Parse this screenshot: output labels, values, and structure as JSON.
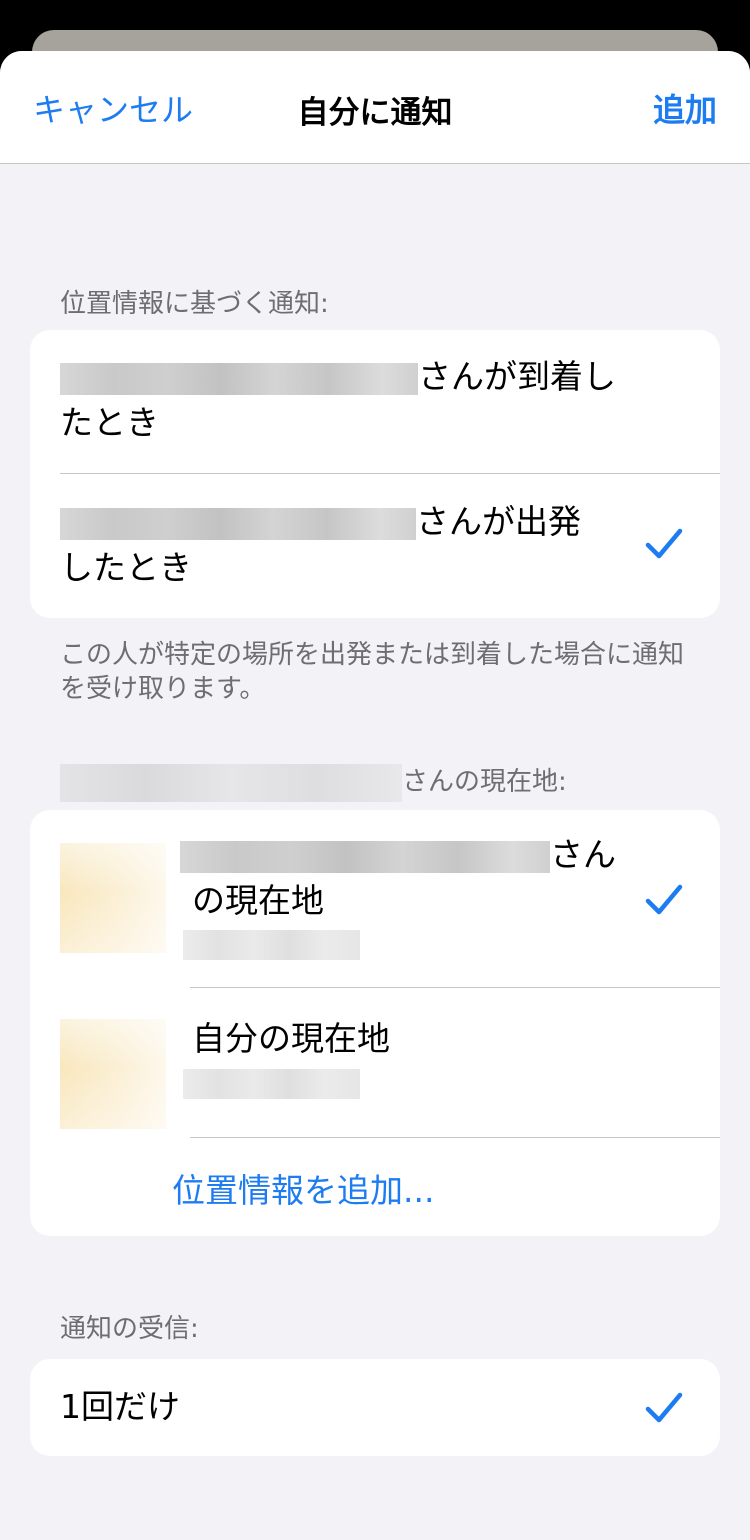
{
  "nav": {
    "cancel_label": "キャンセル",
    "title": "自分に通知",
    "add_label": "追加"
  },
  "location_section": {
    "header": "位置情報に基づく通知:",
    "options": [
      {
        "suffix_line1": "さんが到着し",
        "line2": "たとき",
        "checked": false
      },
      {
        "suffix_line1": "さんが出発",
        "line2": "したとき",
        "checked": true
      }
    ],
    "footer": "この人が特定の場所を出発または到着した場合に通知を受け取ります。"
  },
  "current_location_section": {
    "header_suffix": "さんの現在地:",
    "items": [
      {
        "suffix_line1": "さん",
        "line2": "の現在地",
        "checked": true
      },
      {
        "title": "自分の現在地",
        "checked": false
      }
    ],
    "add_location_label": "位置情報を追加..."
  },
  "receive_section": {
    "header": "通知の受信:",
    "option_label": "1回だけ",
    "checked": true
  },
  "colors": {
    "accent": "#1e7cf2",
    "background": "#f2f2f7",
    "secondary_text": "#6d6d72"
  },
  "icons": [
    "checkmark-icon",
    "avatar-thumbnail"
  ]
}
